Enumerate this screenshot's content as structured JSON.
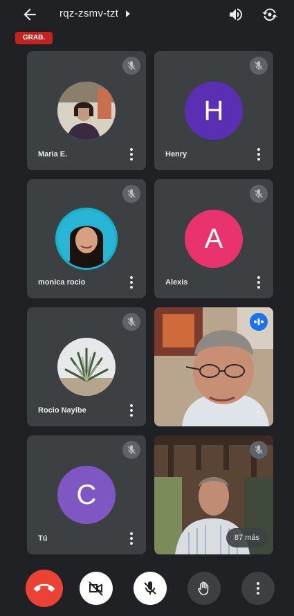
{
  "header": {
    "meeting_code": "rqz-zsmv-tzt",
    "recording_label": "GRAB."
  },
  "tiles": [
    {
      "name": "Maria E.",
      "type": "photo"
    },
    {
      "name": "Henry",
      "type": "initial",
      "initial": "H",
      "color": "#5b2fb3"
    },
    {
      "name": "monica rocio",
      "type": "photo"
    },
    {
      "name": "Alexis",
      "type": "initial",
      "initial": "A",
      "color": "#e8336f"
    },
    {
      "name": "Rocio Nayibe",
      "type": "photo"
    },
    {
      "name": "",
      "type": "video",
      "speaking": true
    },
    {
      "name": "Tú",
      "type": "initial",
      "initial": "C",
      "color": "#7e57c2"
    },
    {
      "name": "",
      "type": "video",
      "more_label": "87 más"
    }
  ],
  "colors": {
    "background": "#202124",
    "tile": "#3c4043",
    "end_call": "#ea4335",
    "recording": "#c5221f",
    "speaking": "#1a73e8"
  },
  "icons": {
    "back": "arrow-left-icon",
    "speaker": "volume-icon",
    "switch_camera": "camera-switch-icon",
    "mic_off": "mic-off-icon",
    "more": "more-vertical-icon",
    "end_call": "phone-hangup-icon",
    "camera_off": "video-off-icon",
    "raise_hand": "hand-icon"
  }
}
